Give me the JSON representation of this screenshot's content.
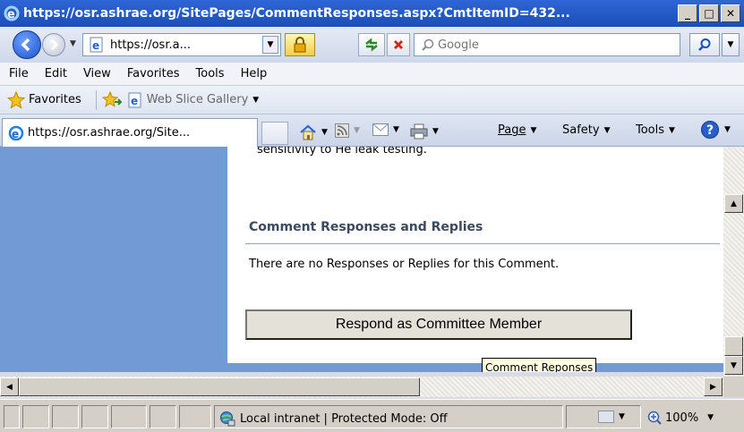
{
  "window": {
    "title": "https://osr.ashrae.org/SitePages/CommentResponses.aspx?CmtItemID=432...",
    "minimize": "_",
    "maximize": "□",
    "close": "✕"
  },
  "address_bar": {
    "url": "https://osr.a...",
    "search_placeholder": "Google"
  },
  "menu": {
    "items": [
      "File",
      "Edit",
      "View",
      "Favorites",
      "Tools",
      "Help"
    ]
  },
  "favorites_bar": {
    "favorites_label": "Favorites",
    "web_slice_label": "Web Slice Gallery"
  },
  "tab": {
    "label": "https://osr.ashrae.org/Site..."
  },
  "command_bar": {
    "page_label": "Page",
    "safety_label": "Safety",
    "tools_label": "Tools"
  },
  "content": {
    "cut_off_text": "sensitivity to He leak testing.",
    "section_title": "Comment Responses and Replies",
    "no_responses_text": "There are no Responses or Replies for this Comment.",
    "respond_button": "Respond as Committee Member",
    "tooltip": "Comment Reponses"
  },
  "status_bar": {
    "zone": "Local intranet | Protected Mode: Off",
    "zoom": "100%"
  },
  "colors": {
    "title_bar": "#1b4fb8",
    "page_background": "#729bd6",
    "section_title": "#3b4a5e"
  }
}
